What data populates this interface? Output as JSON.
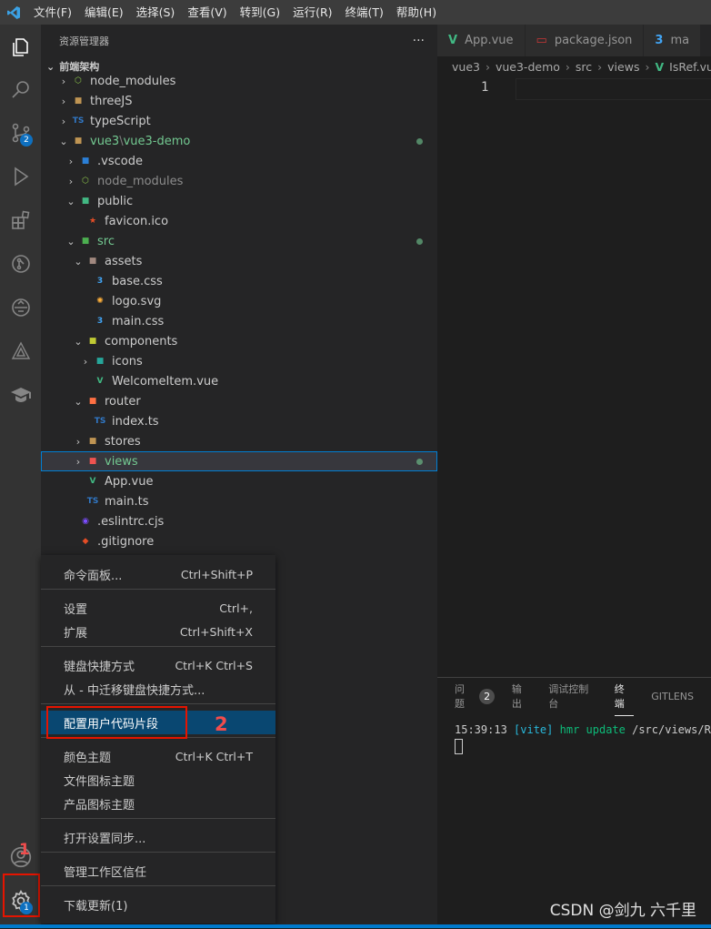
{
  "menubar": [
    "文件(F)",
    "编辑(E)",
    "选择(S)",
    "查看(V)",
    "转到(G)",
    "运行(R)",
    "终端(T)",
    "帮助(H)"
  ],
  "activity": {
    "scm_badge": "2",
    "settings_badge": "1"
  },
  "sidebar": {
    "title": "资源管理器",
    "more": "···",
    "section": "前端架构",
    "items": [
      {
        "label": "node_modules",
        "chev": "›",
        "icon": "⬡",
        "icolor": "#8bc34a",
        "indent": 0
      },
      {
        "label": "threeJS",
        "chev": "›",
        "icon": "■",
        "icolor": "#c09553",
        "indent": 0
      },
      {
        "label": "typeScript",
        "chev": "›",
        "icon": "TS",
        "icolor": "#3178c6",
        "indent": 0
      },
      {
        "label": "vue3",
        "label2": "vue3-demo",
        "chev": "⌄",
        "icon": "■",
        "icolor": "#c09553",
        "indent": 0,
        "green": true,
        "dot": true
      },
      {
        "label": ".vscode",
        "chev": "›",
        "icon": "■",
        "icolor": "#2b7fd6",
        "indent": 1
      },
      {
        "label": "node_modules",
        "chev": "›",
        "icon": "⬡",
        "icolor": "#8bc34a",
        "indent": 1,
        "dim": true
      },
      {
        "label": "public",
        "chev": "⌄",
        "icon": "■",
        "icolor": "#42b883",
        "indent": 1
      },
      {
        "label": "favicon.ico",
        "chev": "",
        "icon": "★",
        "icolor": "#e44d26",
        "indent": 2
      },
      {
        "label": "src",
        "chev": "⌄",
        "icon": "■",
        "icolor": "#4caf50",
        "indent": 1,
        "green": true,
        "dot": true
      },
      {
        "label": "assets",
        "chev": "⌄",
        "icon": "■",
        "icolor": "#a1887f",
        "indent": 2
      },
      {
        "label": "base.css",
        "chev": "",
        "icon": "3",
        "icolor": "#42a5f5",
        "indent": 3
      },
      {
        "label": "logo.svg",
        "chev": "",
        "icon": "✺",
        "icolor": "#ffb13b",
        "indent": 3
      },
      {
        "label": "main.css",
        "chev": "",
        "icon": "3",
        "icolor": "#42a5f5",
        "indent": 3
      },
      {
        "label": "components",
        "chev": "⌄",
        "icon": "■",
        "icolor": "#c0ca33",
        "indent": 2
      },
      {
        "label": "icons",
        "chev": "›",
        "icon": "■",
        "icolor": "#26a69a",
        "indent": 3
      },
      {
        "label": "WelcomeItem.vue",
        "chev": "",
        "icon": "V",
        "icolor": "#41b883",
        "indent": 3
      },
      {
        "label": "router",
        "chev": "⌄",
        "icon": "■",
        "icolor": "#ff7043",
        "indent": 2
      },
      {
        "label": "index.ts",
        "chev": "",
        "icon": "TS",
        "icolor": "#3178c6",
        "indent": 3
      },
      {
        "label": "stores",
        "chev": "›",
        "icon": "■",
        "icolor": "#c09553",
        "indent": 2
      },
      {
        "label": "views",
        "chev": "›",
        "icon": "■",
        "icolor": "#ef5350",
        "indent": 2,
        "selected": true,
        "green": true,
        "dot": true
      },
      {
        "label": "App.vue",
        "chev": "",
        "icon": "V",
        "icolor": "#41b883",
        "indent": 2
      },
      {
        "label": "main.ts",
        "chev": "",
        "icon": "TS",
        "icolor": "#3178c6",
        "indent": 2
      },
      {
        "label": ".eslintrc.cjs",
        "chev": "",
        "icon": "◉",
        "icolor": "#7c4dff",
        "indent": 1
      },
      {
        "label": ".gitignore",
        "chev": "",
        "icon": "◆",
        "icolor": "#e44d26",
        "indent": 1
      }
    ]
  },
  "tabs": [
    {
      "label": "App.vue",
      "icon": "V",
      "icolor": "#41b883"
    },
    {
      "label": "package.json",
      "icon": "▭",
      "icolor": "#cb3837"
    },
    {
      "label": "ma",
      "icon": "3",
      "icolor": "#42a5f5"
    }
  ],
  "breadcrumb": [
    "vue3",
    "vue3-demo",
    "src",
    "views",
    "IsRef.vue"
  ],
  "editor": {
    "line": "1"
  },
  "panel": {
    "tabs": [
      "问题",
      "输出",
      "调试控制台",
      "终端",
      "GITLENS"
    ],
    "problems_count": "2",
    "term_time": "15:39:13",
    "term_vite": "[vite]",
    "term_msg": "hmr update",
    "term_path": "/src/views/Re"
  },
  "menu": {
    "items": [
      {
        "label": "命令面板...",
        "kb": "Ctrl+Shift+P"
      },
      {
        "label": "设置",
        "kb": "Ctrl+,"
      },
      {
        "label": "扩展",
        "kb": "Ctrl+Shift+X"
      },
      {
        "label": "键盘快捷方式",
        "kb": "Ctrl+K Ctrl+S"
      },
      {
        "label": "从 - 中迁移键盘快捷方式...",
        "kb": ""
      },
      {
        "label": "配置用户代码片段",
        "kb": ""
      },
      {
        "label": "颜色主题",
        "kb": "Ctrl+K Ctrl+T"
      },
      {
        "label": "文件图标主题",
        "kb": ""
      },
      {
        "label": "产品图标主题",
        "kb": ""
      },
      {
        "label": "打开设置同步...",
        "kb": ""
      },
      {
        "label": "管理工作区信任",
        "kb": ""
      },
      {
        "label": "下载更新(1)",
        "kb": ""
      }
    ]
  },
  "annotations": {
    "step1": "1",
    "step2": "2"
  },
  "watermark": "CSDN @剑九 六千里"
}
